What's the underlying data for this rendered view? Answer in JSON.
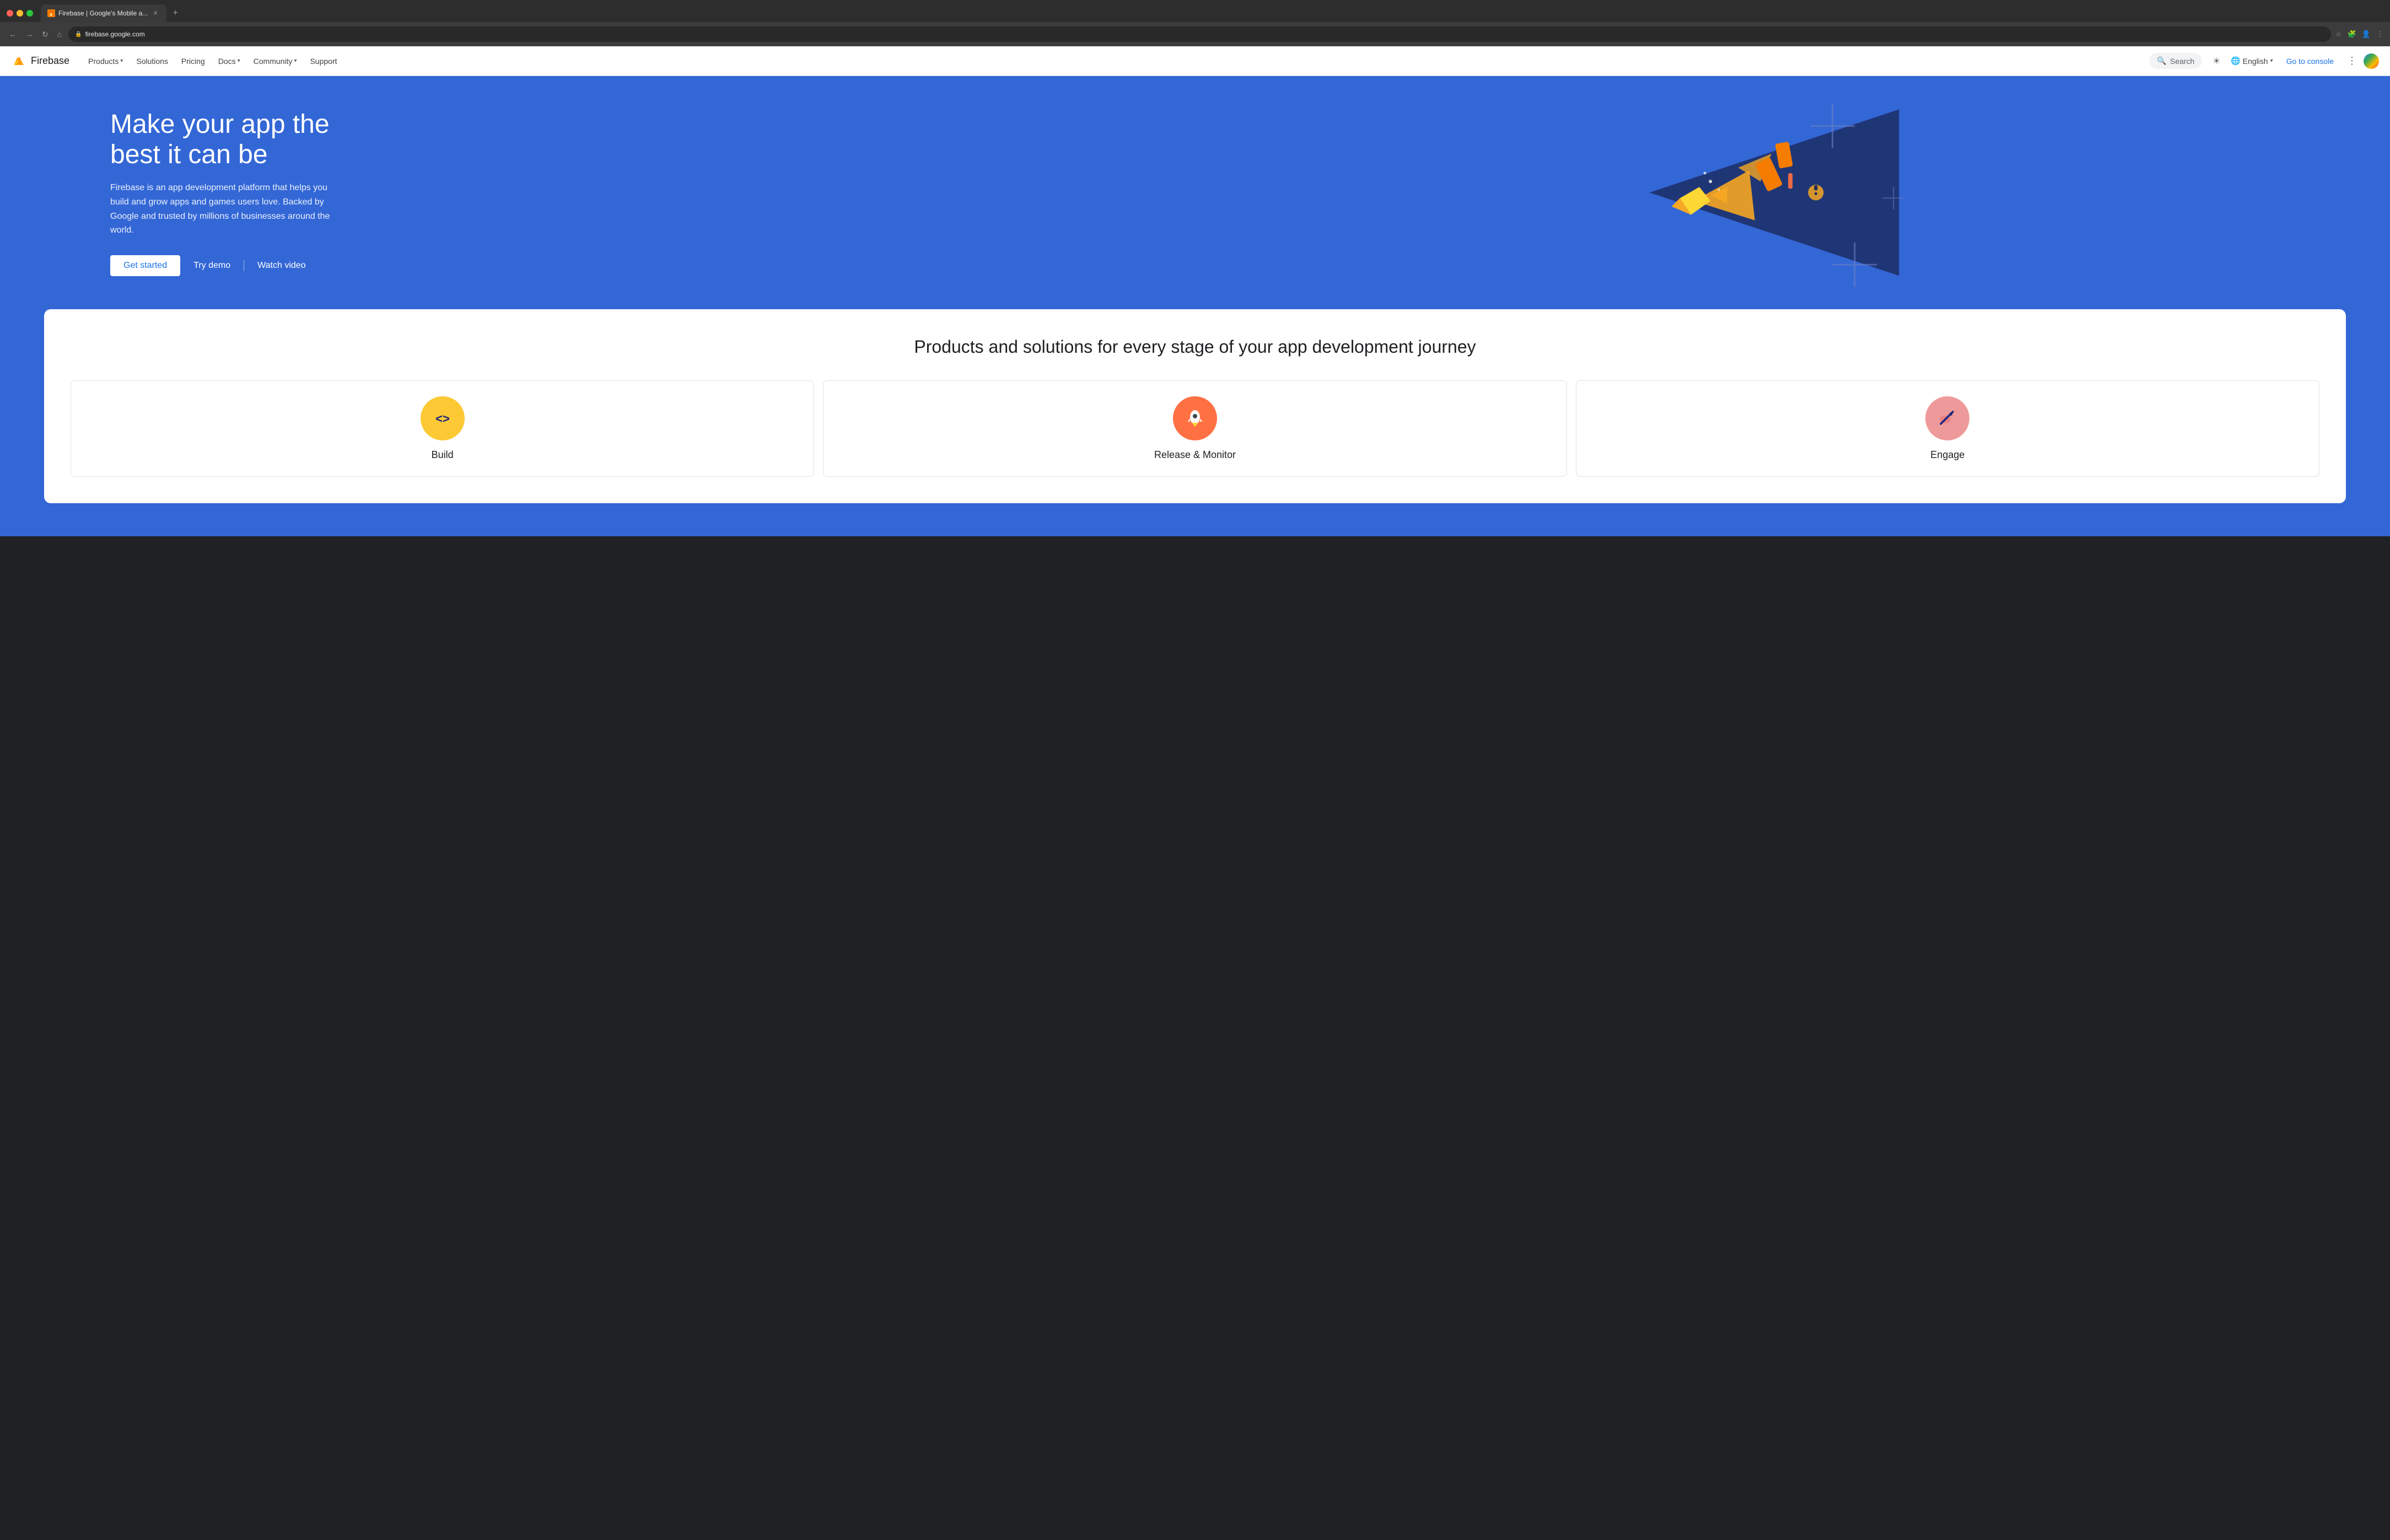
{
  "browser": {
    "tab_title": "Firebase | Google's Mobile a...",
    "url": "firebase.google.com",
    "new_tab_label": "+",
    "nav_back": "←",
    "nav_forward": "→",
    "nav_refresh": "↻",
    "nav_home": "⌂"
  },
  "nav": {
    "logo_text": "Firebase",
    "links": [
      {
        "id": "products",
        "label": "Products",
        "has_dropdown": true
      },
      {
        "id": "solutions",
        "label": "Solutions",
        "has_dropdown": false
      },
      {
        "id": "pricing",
        "label": "Pricing",
        "has_dropdown": false
      },
      {
        "id": "docs",
        "label": "Docs",
        "has_dropdown": true
      },
      {
        "id": "community",
        "label": "Community",
        "has_dropdown": true
      },
      {
        "id": "support",
        "label": "Support",
        "has_dropdown": false
      }
    ],
    "search_placeholder": "Search",
    "language": "English",
    "go_to_console": "Go to console"
  },
  "hero": {
    "title": "Make your app the best it can be",
    "description": "Firebase is an app development platform that helps you build and grow apps and games users love. Backed by Google and trusted by millions of businesses around the world.",
    "cta_get_started": "Get started",
    "cta_try_demo": "Try demo",
    "cta_watch_video": "Watch video"
  },
  "products_section": {
    "title": "Products and solutions for every stage of your app development journey",
    "cards": [
      {
        "id": "build",
        "label": "Build",
        "icon": "code-icon",
        "icon_symbol": "<>"
      },
      {
        "id": "release",
        "label": "Release & Monitor",
        "icon": "rocket-icon",
        "icon_symbol": "🚀"
      },
      {
        "id": "engage",
        "label": "Engage",
        "icon": "chart-icon",
        "icon_symbol": "↗"
      }
    ]
  }
}
